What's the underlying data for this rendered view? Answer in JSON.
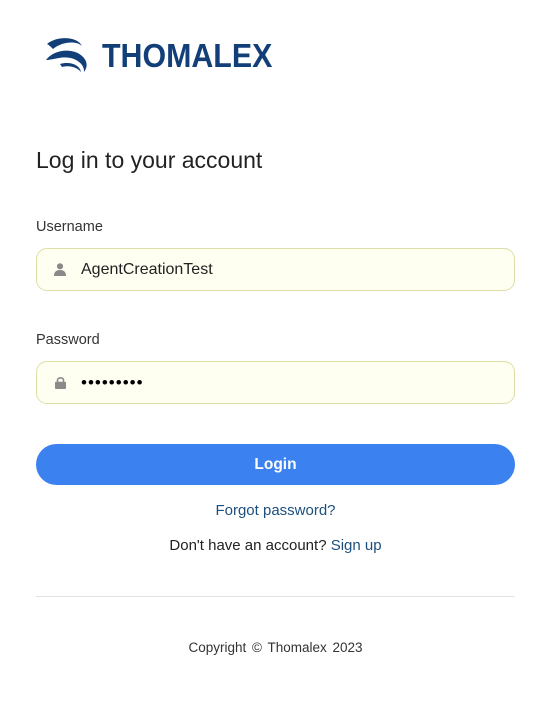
{
  "brand": {
    "name": "THOMALEX",
    "primary_color": "#133f78",
    "logo_icon": "swoosh-logo-icon"
  },
  "form": {
    "title": "Log in to your account",
    "username": {
      "label": "Username",
      "value": "AgentCreationTest",
      "icon": "user-icon"
    },
    "password": {
      "label": "Password",
      "masked_value": "•••••••••",
      "icon": "lock-icon"
    },
    "login_button": "Login",
    "login_button_color": "#3b82f0",
    "forgot_password": "Forgot password?",
    "signup_prompt": "Don't have an account?",
    "signup_link": "Sign up"
  },
  "footer": {
    "copyright": "Copyright ©  Thomalex  2023"
  }
}
